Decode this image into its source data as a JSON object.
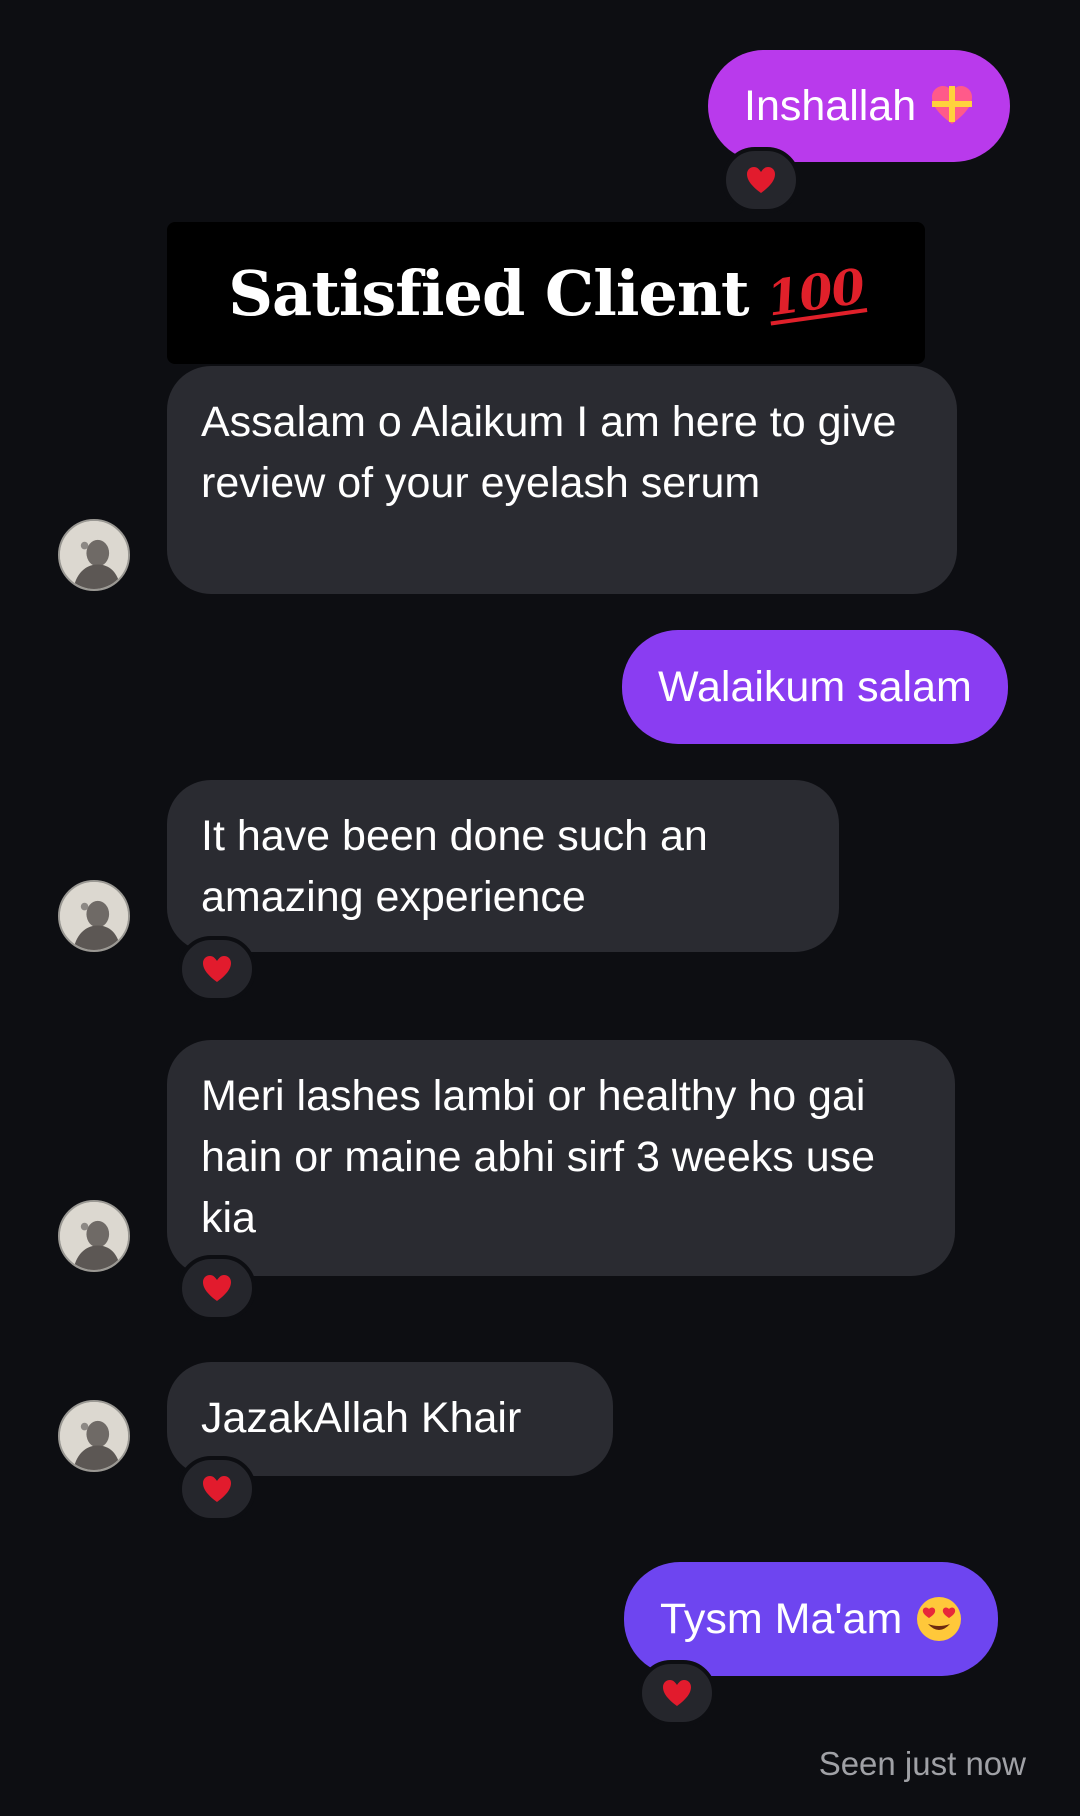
{
  "banner": {
    "title": "Satisfied Client",
    "badge": "100"
  },
  "messages": [
    {
      "text": "Inshallah",
      "emoji": "heart-with-ribbon"
    },
    {
      "text": "Assalam o Alaikum I am here to give review of your eyelash serum"
    },
    {
      "text": "Walaikum salam"
    },
    {
      "text": "It have been done such an amazing experience"
    },
    {
      "text": "Meri lashes lambi or healthy ho gai hain or maine abhi sirf 3 weeks use kia"
    },
    {
      "text": "JazakAllah Khair"
    },
    {
      "text": "Tysm Ma'am",
      "emoji": "heart-eyes"
    }
  ],
  "status": {
    "seen": "Seen just now"
  },
  "colors": {
    "background": "#0d0e12",
    "incoming_bubble": "#2a2b31",
    "outgoing_top": "#b43cf0",
    "outgoing_mid": "#8a3df2",
    "outgoing_bottom": "#6e45f0",
    "reaction_heart": "#e21b2d"
  },
  "reactions": {
    "icon": "red-heart-icon"
  }
}
